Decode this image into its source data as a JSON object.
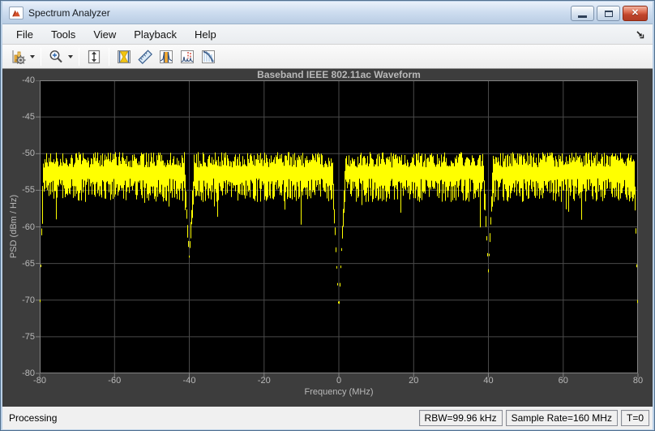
{
  "window": {
    "title": "Spectrum Analyzer",
    "controls": [
      "minimize",
      "maximize",
      "close"
    ]
  },
  "menu": {
    "items": [
      "File",
      "Tools",
      "View",
      "Playback",
      "Help"
    ],
    "dock_icon": "dock-arrow-icon"
  },
  "toolbar": {
    "icons": [
      "configuration-properties-icon",
      "dropdown-caret-icon",
      "zoom-in-icon",
      "dropdown-caret-icon",
      "scale-y-axis-icon",
      "cursor-measurements-icon",
      "peak-finder-icon",
      "channel-measurements-icon",
      "distortion-measurements-icon",
      "ccdf-measurements-icon"
    ]
  },
  "statusbar": {
    "status": "Processing",
    "panels": [
      "RBW=99.96 kHz",
      "Sample Rate=160 MHz",
      "T=0"
    ]
  },
  "chart_data": {
    "type": "line",
    "title": "Baseband IEEE 802.11ac Waveform",
    "xlabel": "Frequency (MHz)",
    "ylabel": "PSD (dBm / Hz)",
    "xlim": [
      -80,
      80
    ],
    "ylim": [
      -80,
      -40
    ],
    "x_ticks": [
      -80,
      -60,
      -40,
      -20,
      0,
      20,
      40,
      60,
      80
    ],
    "y_ticks": [
      -40,
      -45,
      -50,
      -55,
      -60,
      -65,
      -70,
      -75,
      -80
    ],
    "grid": true,
    "legend": false,
    "colors": {
      "trace": "#ffff00",
      "axes_background": "#000000",
      "figure_background": "#3d3d3d",
      "grid": "#4a4a4a",
      "axes_box": "#848484",
      "text": "#b9b9b9"
    },
    "series": [
      {
        "name": "PSD",
        "description": "Noise-like 160 MHz wide OFDM spectrum, flat band with notches at DC and ±40 MHz",
        "band": {
          "mean_psd": -52.5,
          "noise_up_min": 0.6,
          "noise_up_max": 2.7,
          "noise_down_min": 0.9,
          "noise_down_max": 4.1,
          "deep_spike_prob": 0.035,
          "deep_spike_extra": 4.0
        },
        "notches": [
          {
            "x": -40,
            "min_psd": -64.0,
            "width_mhz": 1.3
          },
          {
            "x": 0,
            "min_psd": -71.5,
            "width_mhz": 1.7
          },
          {
            "x": 40,
            "min_psd": -66.0,
            "width_mhz": 1.3
          }
        ],
        "edges": [
          {
            "x": -80,
            "psd": -72.5,
            "ramp_mhz": 0.9
          },
          {
            "x": 80,
            "psd": -72.5,
            "ramp_mhz": 0.9
          }
        ]
      }
    ]
  }
}
